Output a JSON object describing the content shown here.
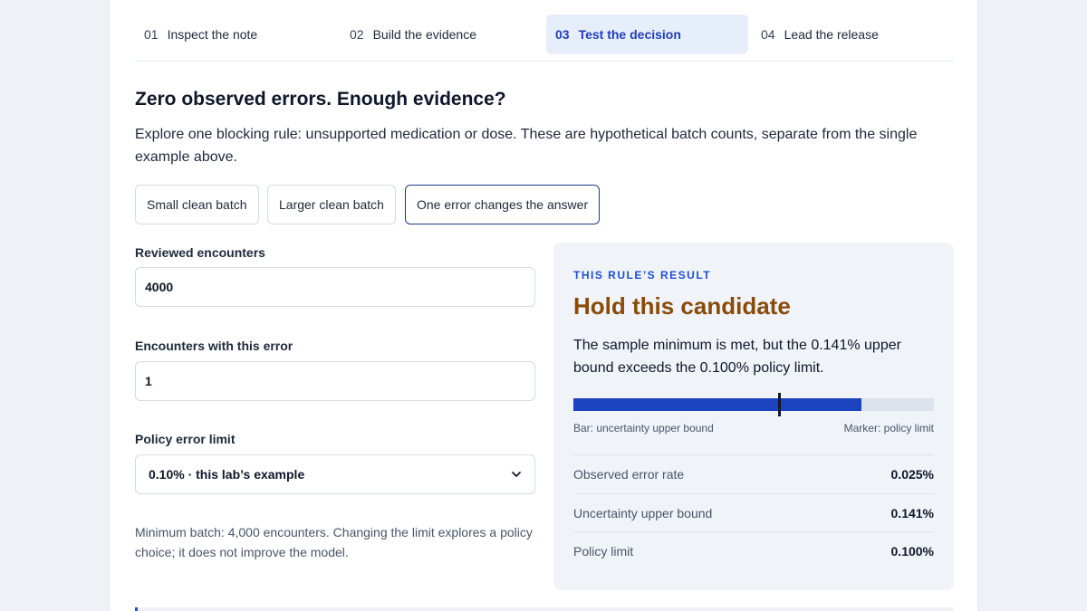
{
  "steps": [
    {
      "num": "01",
      "label": "Inspect the note"
    },
    {
      "num": "02",
      "label": "Build the evidence"
    },
    {
      "num": "03",
      "label": "Test the decision"
    },
    {
      "num": "04",
      "label": "Lead the release"
    }
  ],
  "active_step": 2,
  "heading": "Zero observed errors. Enough evidence?",
  "description": "Explore one blocking rule: unsupported medication or dose. These are hypothetical batch counts, separate from the single example above.",
  "presets": [
    {
      "label": "Small clean batch"
    },
    {
      "label": "Larger clean batch"
    },
    {
      "label": "One error changes the answer"
    }
  ],
  "active_preset": 2,
  "form": {
    "reviewed_label": "Reviewed encounters",
    "reviewed_value": "4000",
    "errors_label": "Encounters with this error",
    "errors_value": "1",
    "limit_label": "Policy error limit",
    "limit_value": "0.10% · this lab’s example",
    "note": "Minimum batch: 4,000 encounters. Changing the limit explores a policy choice; it does not improve the model."
  },
  "result": {
    "eyebrow": "THIS RULE’S RESULT",
    "verdict": "Hold this candidate",
    "explanation": "The sample minimum is met, but the 0.141% upper bound exceeds the 0.100% policy limit.",
    "bar_fill_fraction": 0.8,
    "marker_fraction": 0.57,
    "bar_caption_left": "Bar: uncertainty upper bound",
    "bar_caption_right": "Marker: policy limit",
    "metrics": [
      {
        "label": "Observed error rate",
        "value": "0.025%"
      },
      {
        "label": "Uncertainty upper bound",
        "value": "0.141%"
      },
      {
        "label": "Policy limit",
        "value": "0.100%"
      }
    ]
  },
  "colors": {
    "accent": "#1d44c0",
    "verdict_hold": "#8a4b08",
    "active_step_bg": "#e6eefc"
  },
  "icons": {
    "select_caret": "chevron-down-icon"
  }
}
